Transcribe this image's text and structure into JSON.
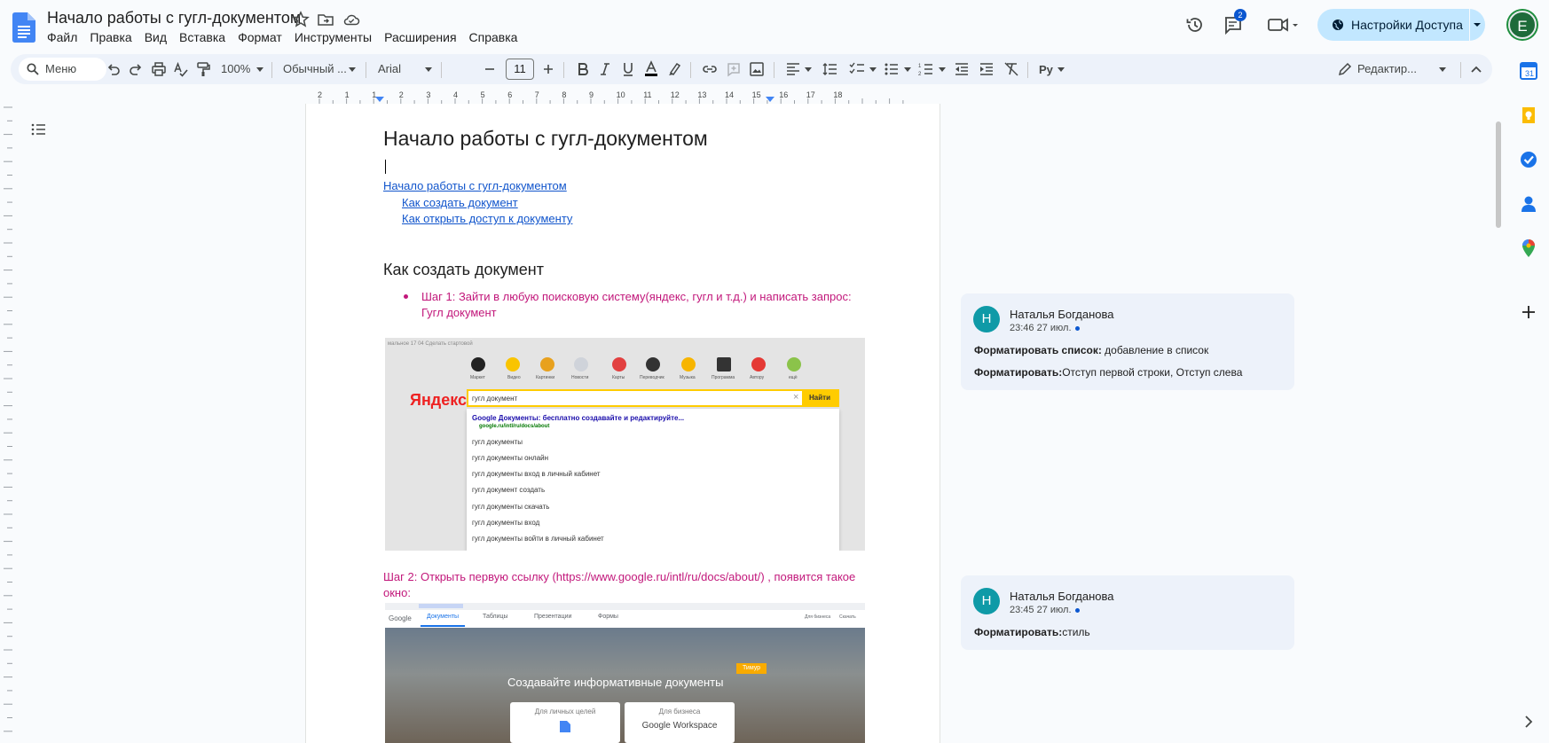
{
  "header": {
    "doc_title": "Начало работы с гугл-документом",
    "menu": [
      "Файл",
      "Правка",
      "Вид",
      "Вставка",
      "Формат",
      "Инструменты",
      "Расширения",
      "Справка"
    ],
    "comments_badge": "2",
    "share_label": "Настройки Доступа",
    "avatar_letter": "E"
  },
  "toolbar": {
    "search_label": "Меню",
    "zoom": "100%",
    "style": "Обычный ...",
    "font": "Arial",
    "font_size": "11",
    "mode_label": "Редактир..."
  },
  "document": {
    "heading": "Начало работы с гугл-документом",
    "toc": [
      "Начало работы с гугл-документом",
      "Как создать документ",
      "Как открыть доступ к документу"
    ],
    "section_heading": "Как создать документ",
    "step1_line1": "Шаг 1: Зайти в любую поисковую систему(яндекс, гугл и т.д.) и написать запрос:",
    "step1_line2": "Гугл документ",
    "step2_line1": "Шаг 2: Открыть первую ссылку (https://www.google.ru/intl/ru/docs/about/) , появится такое",
    "step2_line2": "окно:"
  },
  "screenshot1": {
    "top_left": "мальное 17 04    Сделать стартовой",
    "apps": [
      "Маркет",
      "Видео",
      "Картинки",
      "Новости",
      "Карты",
      "Переводчик",
      "Музыка",
      "Программа",
      "Автору",
      "ещё"
    ],
    "logo": "Яндекс",
    "query": "гугл документ",
    "button": "Найти",
    "first_result_title": "Google Документы: бесплатно создавайте и редактируйте...",
    "first_result_url": "google.ru/intl/ru/docs/about",
    "suggestions": [
      "гугл документы",
      "гугл документы онлайн",
      "гугл документы вход в личный кабинет",
      "гугл документ создать",
      "гугл документы скачать",
      "гугл документы вход",
      "гугл документы войти в личный кабинет"
    ]
  },
  "screenshot2": {
    "google": "Google",
    "tabs": [
      "Документы",
      "Таблицы",
      "Презентации",
      "Формы"
    ],
    "right_links": [
      "Для бизнеса",
      "Скачать"
    ],
    "hero_text": "Создавайте информативные документы",
    "cursor_label": "Тимур",
    "card1": "Для личных целей",
    "card2": "Для бизнеса",
    "card2_brand": "Google Workspace"
  },
  "comments": [
    {
      "avatar": "Н",
      "author": "Наталья Богданова",
      "time": "23:46 27 июл.",
      "lines": [
        {
          "label": "Форматировать список:",
          "text": " добавление в список"
        },
        {
          "label": "Форматировать:",
          "text": "Отступ первой строки, Отступ слева"
        }
      ]
    },
    {
      "avatar": "Н",
      "author": "Наталья Богданова",
      "time": "23:45 27 июл.",
      "lines": [
        {
          "label": "Форматировать:",
          "text": "стиль"
        }
      ]
    }
  ],
  "ruler_numbers": [
    "2",
    "1",
    "1",
    "2",
    "3",
    "4",
    "5",
    "6",
    "7",
    "8",
    "9",
    "10",
    "11",
    "12",
    "13",
    "14",
    "15",
    "16",
    "17",
    "18"
  ],
  "colors": {
    "accent": "#0b57d0",
    "share_bg": "#c2e7ff",
    "suggestion_pink": "#c2187b",
    "link": "#1155cc"
  }
}
